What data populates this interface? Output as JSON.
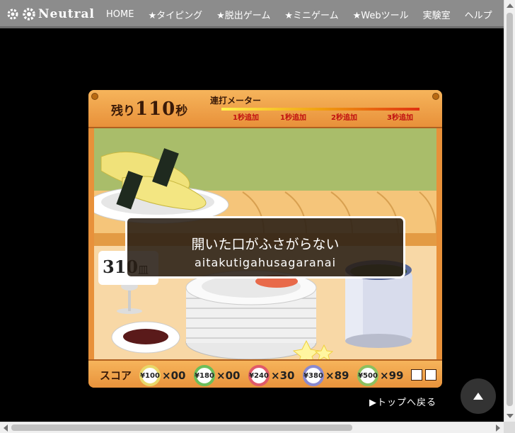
{
  "site": {
    "title": "Neutral"
  },
  "nav": {
    "items": [
      "HOME",
      "★タイピング",
      "★脱出ゲーム",
      "★ミニゲーム",
      "★Webツール",
      "実験室",
      "ヘルプ"
    ]
  },
  "game": {
    "remaining": {
      "prefix": "残り",
      "seconds": "110",
      "suffix": "秒"
    },
    "meter": {
      "title": "連打メーター",
      "bonuses": [
        "1秒追加",
        "1秒追加",
        "2秒追加",
        "3秒追加"
      ]
    },
    "price_card": {
      "value": "310",
      "unit": "皿"
    },
    "prompt": {
      "japanese": "開いた口がふさがらない",
      "romaji": "aitakutigahusagaranai"
    },
    "score": {
      "label": "スコア",
      "plates": [
        {
          "price": "¥100",
          "count": "×00",
          "color": "#e8d86a"
        },
        {
          "price": "¥180",
          "count": "×00",
          "color": "#6cbe5a"
        },
        {
          "price": "¥240",
          "count": "×30",
          "color": "#e05a6a"
        },
        {
          "price": "¥380",
          "count": "×89",
          "color": "#8a8ad0"
        },
        {
          "price": "¥500",
          "count": "×99",
          "color": "#8cc060"
        }
      ]
    }
  },
  "footer": {
    "back_to_top": "▶トップへ戻る"
  },
  "icons": {
    "pagetop": "arrow-up-icon",
    "logo": "gear-icon"
  }
}
